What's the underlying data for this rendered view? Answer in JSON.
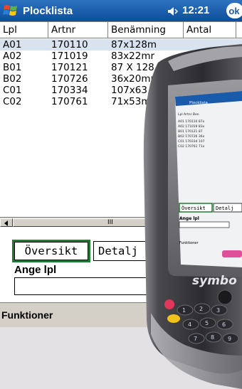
{
  "titlebar": {
    "app_title": "Plocklista",
    "clock": "12:21",
    "ok_label": "ok",
    "start_icon": "windows-flag-icon",
    "speaker_icon": "speaker-icon"
  },
  "table": {
    "columns": [
      "Lpl",
      "Artnr",
      "Benämning",
      "Antal",
      ""
    ],
    "rows": [
      {
        "lpl": "A01",
        "artnr": "170110",
        "benamning": "87x128m"
      },
      {
        "lpl": "A02",
        "artnr": "171019",
        "benamning": "83x22mr"
      },
      {
        "lpl": "B01",
        "artnr": "170121",
        "benamning": "87 X 128"
      },
      {
        "lpl": "B02",
        "artnr": "170726",
        "benamning": "36x20mr"
      },
      {
        "lpl": "C01",
        "artnr": "170334",
        "benamning": "107x63,"
      },
      {
        "lpl": "C02",
        "artnr": "170761",
        "benamning": "71x53m"
      }
    ],
    "scroll_grip": "III"
  },
  "buttons": {
    "oversikt": "Översikt",
    "detalj": "Detalj"
  },
  "form": {
    "ange_lpl_label": "Ange lpl",
    "ange_lpl_value": ""
  },
  "menubar": {
    "funktioner": "Funktioner"
  },
  "device": {
    "brand": "symbo",
    "mini_screen": {
      "title": "Plocklista",
      "buttons": [
        "Översikt",
        "Detalj"
      ],
      "label": "Ange lpl",
      "menu": "Funktioner"
    },
    "keypad": [
      "1",
      "2",
      "3",
      "4",
      "5",
      "6",
      "7",
      "8",
      "9"
    ]
  },
  "colors": {
    "titlebar": "#1a5aaa",
    "selection_row": "#d8e3ef",
    "focus_border": "#1e7a2e",
    "background": "#e3e1e4",
    "device_body": "#3a3a3e"
  }
}
